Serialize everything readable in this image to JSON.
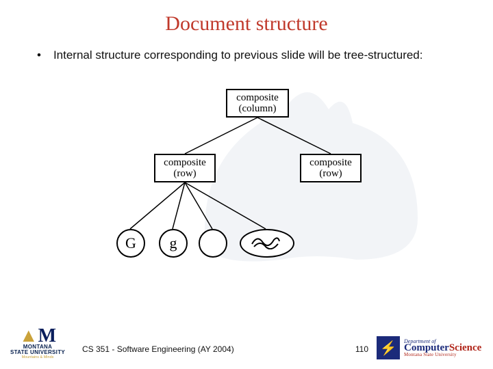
{
  "title": "Document structure",
  "bullet": "Internal structure corresponding to previous slide will be tree-structured:",
  "diagram": {
    "root": {
      "l1": "composite",
      "l2": "(column)"
    },
    "childL": {
      "l1": "composite",
      "l2": "(row)"
    },
    "childR": {
      "l1": "composite",
      "l2": "(row)"
    },
    "leafG": "G",
    "leafg": "g",
    "leafEmpty": "",
    "leafOval": ""
  },
  "footer": {
    "msu": {
      "top": "MONTANA",
      "bottom": "STATE UNIVERSITY",
      "tag": "Mountains & Minds"
    },
    "course": "CS 351 - Software Engineering (AY 2004)",
    "page": "110",
    "cs": {
      "dept": "Department of",
      "main1": "Computer",
      "main2": "Science",
      "uni": "Montana State University"
    }
  }
}
